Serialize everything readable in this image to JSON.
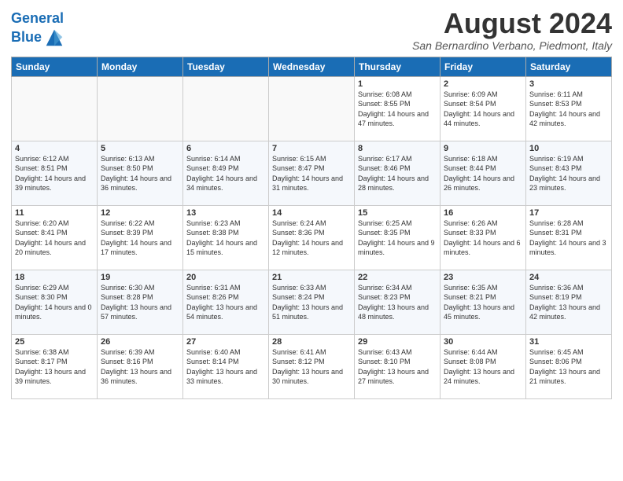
{
  "header": {
    "logo_line1": "General",
    "logo_line2": "Blue",
    "month_title": "August 2024",
    "location": "San Bernardino Verbano, Piedmont, Italy"
  },
  "weekdays": [
    "Sunday",
    "Monday",
    "Tuesday",
    "Wednesday",
    "Thursday",
    "Friday",
    "Saturday"
  ],
  "weeks": [
    [
      {
        "day": "",
        "info": ""
      },
      {
        "day": "",
        "info": ""
      },
      {
        "day": "",
        "info": ""
      },
      {
        "day": "",
        "info": ""
      },
      {
        "day": "1",
        "info": "Sunrise: 6:08 AM\nSunset: 8:55 PM\nDaylight: 14 hours and 47 minutes."
      },
      {
        "day": "2",
        "info": "Sunrise: 6:09 AM\nSunset: 8:54 PM\nDaylight: 14 hours and 44 minutes."
      },
      {
        "day": "3",
        "info": "Sunrise: 6:11 AM\nSunset: 8:53 PM\nDaylight: 14 hours and 42 minutes."
      }
    ],
    [
      {
        "day": "4",
        "info": "Sunrise: 6:12 AM\nSunset: 8:51 PM\nDaylight: 14 hours and 39 minutes."
      },
      {
        "day": "5",
        "info": "Sunrise: 6:13 AM\nSunset: 8:50 PM\nDaylight: 14 hours and 36 minutes."
      },
      {
        "day": "6",
        "info": "Sunrise: 6:14 AM\nSunset: 8:49 PM\nDaylight: 14 hours and 34 minutes."
      },
      {
        "day": "7",
        "info": "Sunrise: 6:15 AM\nSunset: 8:47 PM\nDaylight: 14 hours and 31 minutes."
      },
      {
        "day": "8",
        "info": "Sunrise: 6:17 AM\nSunset: 8:46 PM\nDaylight: 14 hours and 28 minutes."
      },
      {
        "day": "9",
        "info": "Sunrise: 6:18 AM\nSunset: 8:44 PM\nDaylight: 14 hours and 26 minutes."
      },
      {
        "day": "10",
        "info": "Sunrise: 6:19 AM\nSunset: 8:43 PM\nDaylight: 14 hours and 23 minutes."
      }
    ],
    [
      {
        "day": "11",
        "info": "Sunrise: 6:20 AM\nSunset: 8:41 PM\nDaylight: 14 hours and 20 minutes."
      },
      {
        "day": "12",
        "info": "Sunrise: 6:22 AM\nSunset: 8:39 PM\nDaylight: 14 hours and 17 minutes."
      },
      {
        "day": "13",
        "info": "Sunrise: 6:23 AM\nSunset: 8:38 PM\nDaylight: 14 hours and 15 minutes."
      },
      {
        "day": "14",
        "info": "Sunrise: 6:24 AM\nSunset: 8:36 PM\nDaylight: 14 hours and 12 minutes."
      },
      {
        "day": "15",
        "info": "Sunrise: 6:25 AM\nSunset: 8:35 PM\nDaylight: 14 hours and 9 minutes."
      },
      {
        "day": "16",
        "info": "Sunrise: 6:26 AM\nSunset: 8:33 PM\nDaylight: 14 hours and 6 minutes."
      },
      {
        "day": "17",
        "info": "Sunrise: 6:28 AM\nSunset: 8:31 PM\nDaylight: 14 hours and 3 minutes."
      }
    ],
    [
      {
        "day": "18",
        "info": "Sunrise: 6:29 AM\nSunset: 8:30 PM\nDaylight: 14 hours and 0 minutes."
      },
      {
        "day": "19",
        "info": "Sunrise: 6:30 AM\nSunset: 8:28 PM\nDaylight: 13 hours and 57 minutes."
      },
      {
        "day": "20",
        "info": "Sunrise: 6:31 AM\nSunset: 8:26 PM\nDaylight: 13 hours and 54 minutes."
      },
      {
        "day": "21",
        "info": "Sunrise: 6:33 AM\nSunset: 8:24 PM\nDaylight: 13 hours and 51 minutes."
      },
      {
        "day": "22",
        "info": "Sunrise: 6:34 AM\nSunset: 8:23 PM\nDaylight: 13 hours and 48 minutes."
      },
      {
        "day": "23",
        "info": "Sunrise: 6:35 AM\nSunset: 8:21 PM\nDaylight: 13 hours and 45 minutes."
      },
      {
        "day": "24",
        "info": "Sunrise: 6:36 AM\nSunset: 8:19 PM\nDaylight: 13 hours and 42 minutes."
      }
    ],
    [
      {
        "day": "25",
        "info": "Sunrise: 6:38 AM\nSunset: 8:17 PM\nDaylight: 13 hours and 39 minutes."
      },
      {
        "day": "26",
        "info": "Sunrise: 6:39 AM\nSunset: 8:16 PM\nDaylight: 13 hours and 36 minutes."
      },
      {
        "day": "27",
        "info": "Sunrise: 6:40 AM\nSunset: 8:14 PM\nDaylight: 13 hours and 33 minutes."
      },
      {
        "day": "28",
        "info": "Sunrise: 6:41 AM\nSunset: 8:12 PM\nDaylight: 13 hours and 30 minutes."
      },
      {
        "day": "29",
        "info": "Sunrise: 6:43 AM\nSunset: 8:10 PM\nDaylight: 13 hours and 27 minutes."
      },
      {
        "day": "30",
        "info": "Sunrise: 6:44 AM\nSunset: 8:08 PM\nDaylight: 13 hours and 24 minutes."
      },
      {
        "day": "31",
        "info": "Sunrise: 6:45 AM\nSunset: 8:06 PM\nDaylight: 13 hours and 21 minutes."
      }
    ]
  ]
}
